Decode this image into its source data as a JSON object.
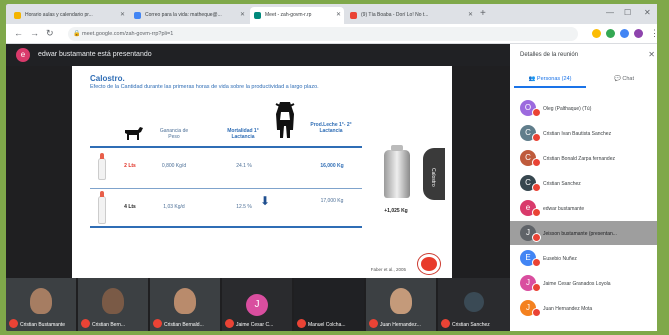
{
  "browser": {
    "tabs": [
      {
        "label": "Horario aulas y calendario pr...",
        "color": "#f4b400"
      },
      {
        "label": "Correo para la vida: matheque@...",
        "color": "#4285f4"
      },
      {
        "label": "Meet - zah-govm-r.rp",
        "color": "#00897b"
      },
      {
        "label": "(9) Tía Boaba - Dorí Lo! No t...",
        "color": "#ea4335"
      }
    ],
    "url": "meet.google.com/zah-govm-rrp?pli=1",
    "new_tab": "+",
    "minimize": "—",
    "maximize": "☐",
    "close": "✕"
  },
  "meeting": {
    "presenter_initial": "e",
    "presenting_text": "edwar bustamante está presentando"
  },
  "slide": {
    "title": "Calostro.",
    "subtitle": "Efecto de la Cantidad durante las primeras horas de vida sobre la productividad a largo plazo.",
    "headers": {
      "gain": "Ganancia de Peso",
      "mortality": "Mortalidad 1° Lactancia",
      "production": "Prod.Leche 1°- 2° Lactancia"
    },
    "rows": [
      {
        "amount": "2 Lts",
        "gain": "0,800 Kg/d",
        "mortality": "24.1 %",
        "production": "16,000 Kg"
      },
      {
        "amount": "4 Lts",
        "gain": "1,03 Kg/d",
        "mortality": "12.5 %",
        "production": "17,000 Kg"
      }
    ],
    "difference": "+1,025 Kg",
    "citation": "Faber et al., 2005",
    "side_tab_label": "Calostro"
  },
  "participants_strip": [
    {
      "name": "Cristian Bustamante",
      "type": "video"
    },
    {
      "name": "Cristian Bern...",
      "type": "video"
    },
    {
      "name": "Cristian Bernald...",
      "type": "video"
    },
    {
      "name": "Jaime Cesar C...",
      "type": "letter",
      "initial": "J"
    },
    {
      "name": "Manuel Colcha...",
      "type": "video"
    },
    {
      "name": "Juan Hernandez...",
      "type": "video"
    },
    {
      "name": "Cristian Sanchez",
      "type": "video"
    }
  ],
  "panel": {
    "title": "Detalles de la reunión",
    "close": "✕",
    "tab_people": "Personas (24)",
    "tab_chat": "Chat",
    "people": [
      {
        "name": "Oleg (Palthaque) (Tú)",
        "initial": "O",
        "color": "#9c6ade"
      },
      {
        "name": "Cristian Ivan Bautista Sanchez",
        "initial": "C",
        "color": "#607d8b"
      },
      {
        "name": "Cristian Bonald Zarpa fernandez",
        "initial": "C",
        "color": "#bf5b3c"
      },
      {
        "name": "Cristian Sanchez",
        "initial": "C",
        "color": "#37474f"
      },
      {
        "name": "edwar bustamante",
        "initial": "e",
        "color": "#d93a6b"
      },
      {
        "name": "Jeisson bustamante (presentan...",
        "initial": "J",
        "color": "#5f6368"
      },
      {
        "name": "Eusebio Nuñez",
        "initial": "E",
        "color": "#4285f4"
      },
      {
        "name": "Jaime Cesar Granados Loyola",
        "initial": "J",
        "color": "#d94e9f"
      },
      {
        "name": "Juan Hernandez Mota",
        "initial": "J",
        "color": "#f4811f"
      }
    ]
  }
}
